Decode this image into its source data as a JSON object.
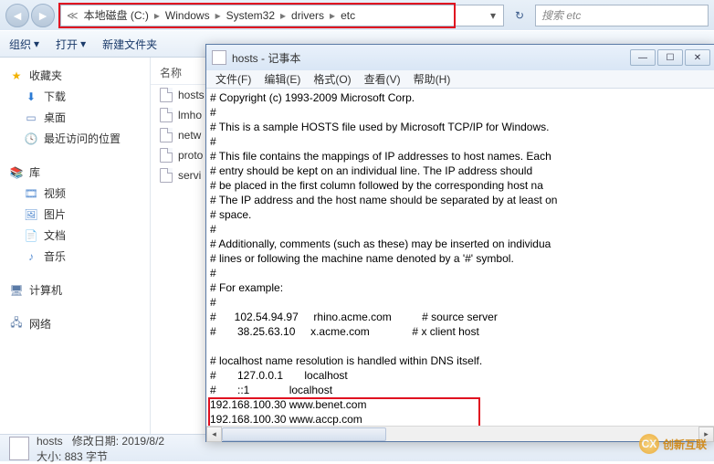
{
  "explorer": {
    "breadcrumbs": [
      "本地磁盘 (C:)",
      "Windows",
      "System32",
      "drivers",
      "etc"
    ],
    "search_placeholder": "搜索 etc",
    "toolbar": {
      "organize": "组织",
      "open": "打开",
      "new_file": "新建文件夹"
    },
    "sidebar": {
      "favorites": {
        "label": "收藏夹",
        "items": [
          "下载",
          "桌面",
          "最近访问的位置"
        ]
      },
      "libraries": {
        "label": "库",
        "items": [
          "视频",
          "图片",
          "文档",
          "音乐"
        ]
      },
      "computer": {
        "label": "计算机"
      },
      "network": {
        "label": "网络"
      }
    },
    "list": {
      "header": "名称",
      "files": [
        "hosts",
        "lmho",
        "netw",
        "proto",
        "servi"
      ]
    },
    "status": {
      "filename": "hosts",
      "mod_label": "修改日期:",
      "mod_value": "2019/8/2",
      "size_label": "大小:",
      "size_value": "883 字节"
    }
  },
  "notepad": {
    "title": "hosts - 记事本",
    "menu": {
      "file": "文件(F)",
      "edit": "编辑(E)",
      "format": "格式(O)",
      "view": "查看(V)",
      "help": "帮助(H)"
    },
    "content_lines": [
      "# Copyright (c) 1993-2009 Microsoft Corp.",
      "#",
      "# This is a sample HOSTS file used by Microsoft TCP/IP for Windows.",
      "#",
      "# This file contains the mappings of IP addresses to host names. Each",
      "# entry should be kept on an individual line. The IP address should",
      "# be placed in the first column followed by the corresponding host na",
      "# The IP address and the host name should be separated by at least on",
      "# space.",
      "#",
      "# Additionally, comments (such as these) may be inserted on individua",
      "# lines or following the machine name denoted by a '#' symbol.",
      "#",
      "# For example:",
      "#",
      "#      102.54.94.97     rhino.acme.com          # source server",
      "#       38.25.63.10     x.acme.com              # x client host",
      "",
      "# localhost name resolution is handled within DNS itself.",
      "#       127.0.0.1       localhost",
      "#       ::1             localhost",
      "192.168.100.30 www.benet.com",
      "192.168.100.30 www.accp.com"
    ]
  },
  "watermark": "创新互联"
}
